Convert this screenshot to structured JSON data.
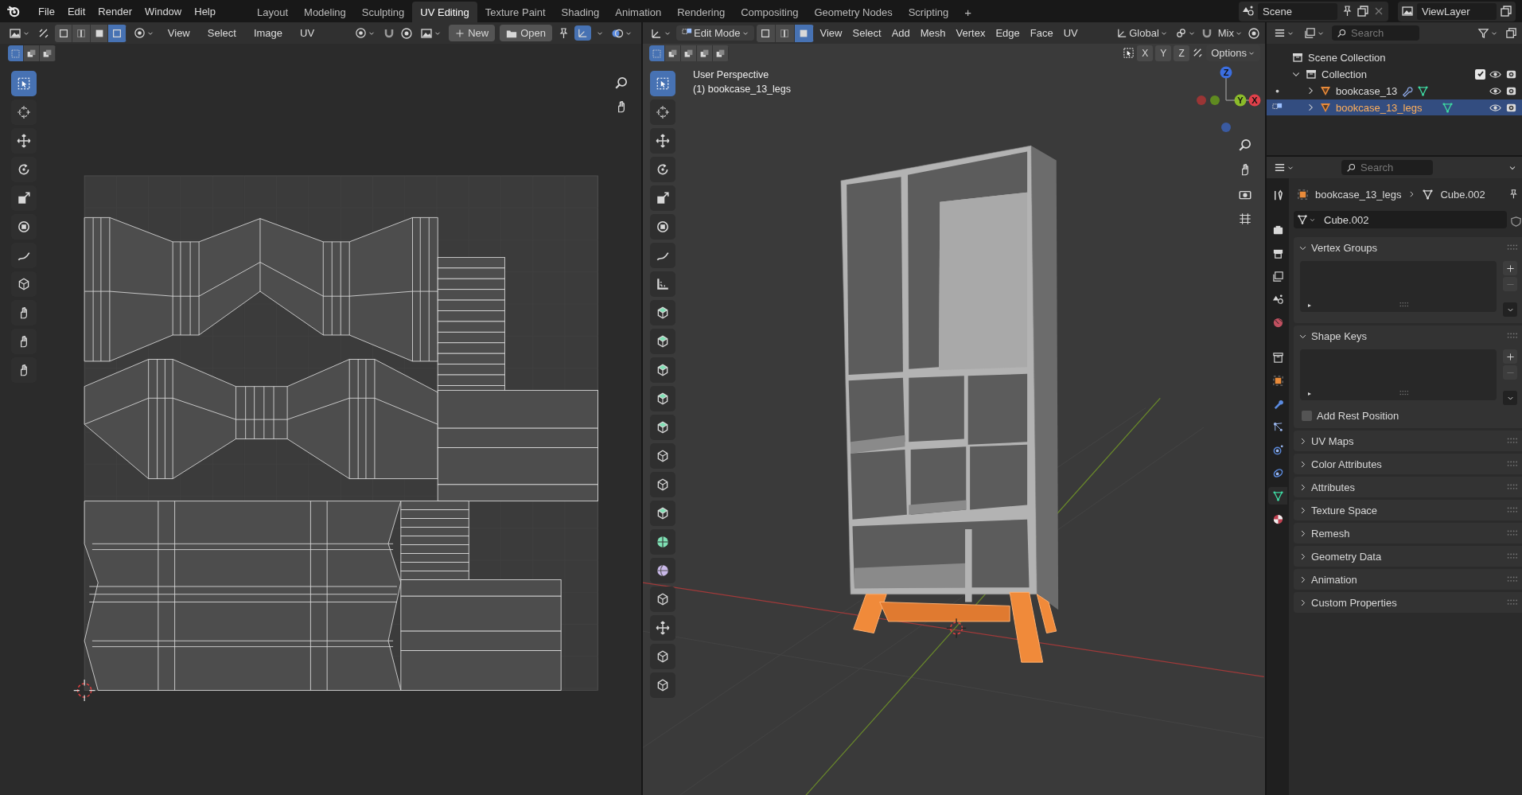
{
  "topbar": {
    "menus": [
      "File",
      "Edit",
      "Render",
      "Window",
      "Help"
    ],
    "workspaces": [
      {
        "label": "Layout",
        "selected": false
      },
      {
        "label": "Modeling",
        "selected": false
      },
      {
        "label": "Sculpting",
        "selected": false
      },
      {
        "label": "UV Editing",
        "selected": true
      },
      {
        "label": "Texture Paint",
        "selected": false
      },
      {
        "label": "Shading",
        "selected": false
      },
      {
        "label": "Animation",
        "selected": false
      },
      {
        "label": "Rendering",
        "selected": false
      },
      {
        "label": "Compositing",
        "selected": false
      },
      {
        "label": "Geometry Nodes",
        "selected": false
      },
      {
        "label": "Scripting",
        "selected": false
      }
    ],
    "add_workspace": "+",
    "scene": "Scene",
    "view_layer": "ViewLayer"
  },
  "uv_editor": {
    "select_modes": [
      {
        "selected": false
      },
      {
        "selected": false
      },
      {
        "selected": false
      },
      {
        "selected": true
      }
    ],
    "menus": [
      "View",
      "Select",
      "Image",
      "UV"
    ],
    "new_button": "New",
    "open_button": "Open",
    "box_modes": [
      {
        "selected": true
      },
      {
        "selected": false
      },
      {
        "selected": false
      }
    ],
    "tools": [
      {
        "selected": true
      },
      {
        "selected": false
      },
      {
        "selected": false
      },
      {
        "selected": false
      },
      {
        "selected": false
      },
      {
        "selected": false
      },
      {
        "selected": false
      },
      {
        "selected": false
      },
      {
        "selected": false
      },
      {
        "selected": false
      },
      {
        "selected": false
      }
    ]
  },
  "viewport": {
    "mode": "Edit Mode",
    "select_modes": [
      {
        "selected": false
      },
      {
        "selected": false
      },
      {
        "selected": true
      }
    ],
    "menus": [
      "View",
      "Select",
      "Add",
      "Mesh",
      "Vertex",
      "Edge",
      "Face",
      "UV"
    ],
    "orientation": "Global",
    "snapping": "Mix",
    "box_modes": [
      {
        "selected": true
      },
      {
        "selected": false
      },
      {
        "selected": false
      },
      {
        "selected": false
      },
      {
        "selected": false
      }
    ],
    "mirror_axes": [
      "X",
      "Y",
      "Z"
    ],
    "options": "Options",
    "view_name": "User Perspective",
    "object_label": "(1) bookcase_13_legs",
    "gizmo_axes": [
      "Z",
      "Y",
      "X"
    ],
    "tools": [
      {
        "selected": true
      },
      {
        "selected": false
      },
      {
        "selected": false
      },
      {
        "selected": false
      },
      {
        "selected": false
      },
      {
        "selected": false
      },
      {
        "selected": false
      },
      {
        "selected": false
      },
      {
        "selected": false
      },
      {
        "selected": false
      },
      {
        "selected": false
      },
      {
        "selected": false
      },
      {
        "selected": false
      },
      {
        "selected": false
      },
      {
        "selected": false
      },
      {
        "selected": false
      },
      {
        "selected": false
      },
      {
        "selected": false
      },
      {
        "selected": false
      },
      {
        "selected": false
      },
      {
        "selected": false
      },
      {
        "selected": false
      }
    ]
  },
  "outliner": {
    "search_placeholder": "Search",
    "tree": [
      {
        "label": "Scene Collection",
        "children": [
          {
            "label": "Collection",
            "expanded": true,
            "checked": true,
            "children": [
              {
                "label": "bookcase_13",
                "expanded": false,
                "selected": false,
                "modifiers": true,
                "in_edit_mode": false
              },
              {
                "label": "bookcase_13_legs",
                "expanded": false,
                "selected": true,
                "modifiers": false,
                "in_edit_mode": true
              }
            ]
          }
        ]
      }
    ]
  },
  "properties": {
    "search_placeholder": "Search",
    "object": "bookcase_13_legs",
    "mesh": "Cube.002",
    "mesh_name": "Cube.002",
    "tabs": [
      {
        "selected": false
      },
      {
        "selected": false
      },
      {
        "selected": false
      },
      {
        "selected": false
      },
      {
        "selected": false
      },
      {
        "selected": false
      },
      {
        "selected": false
      },
      {
        "selected": false
      },
      {
        "selected": false
      },
      {
        "selected": false
      },
      {
        "selected": false
      },
      {
        "selected": false
      },
      {
        "selected": true
      },
      {
        "selected": false
      }
    ],
    "panels": [
      {
        "title": "Vertex Groups",
        "expanded": true
      },
      {
        "title": "Shape Keys",
        "expanded": true,
        "checkbox": {
          "label": "Add Rest Position",
          "checked": false
        }
      },
      {
        "title": "UV Maps",
        "expanded": false
      },
      {
        "title": "Color Attributes",
        "expanded": false
      },
      {
        "title": "Attributes",
        "expanded": false
      },
      {
        "title": "Texture Space",
        "expanded": false
      },
      {
        "title": "Remesh",
        "expanded": false
      },
      {
        "title": "Geometry Data",
        "expanded": false
      },
      {
        "title": "Animation",
        "expanded": false
      },
      {
        "title": "Custom Properties",
        "expanded": false
      }
    ]
  }
}
